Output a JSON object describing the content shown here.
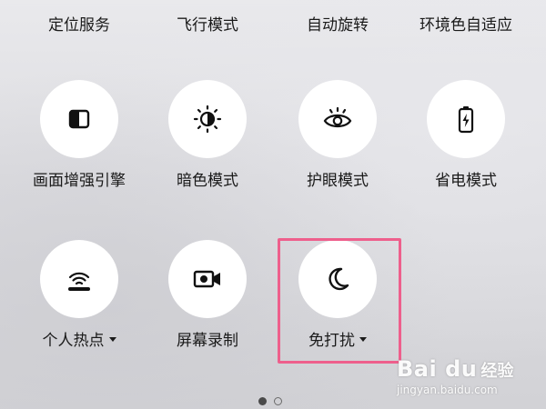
{
  "top_row": [
    {
      "label": "定位服务"
    },
    {
      "label": "飞行模式"
    },
    {
      "label": "自动旋转"
    },
    {
      "label": "环境色自适应"
    }
  ],
  "tiles": [
    {
      "label": "画面增强引擎",
      "icon": "display-enhance-icon",
      "state": "off"
    },
    {
      "label": "暗色模式",
      "icon": "dark-mode-icon",
      "state": "off"
    },
    {
      "label": "护眼模式",
      "icon": "eye-icon",
      "state": "off"
    },
    {
      "label": "省电模式",
      "icon": "battery-saver-icon",
      "state": "off"
    },
    {
      "label": "个人热点",
      "icon": "hotspot-icon",
      "state": "off",
      "has_dropdown": true
    },
    {
      "label": "屏幕录制",
      "icon": "screen-record-icon",
      "state": "off"
    },
    {
      "label": "免打扰",
      "icon": "moon-icon",
      "state": "off",
      "has_dropdown": true,
      "highlighted": true
    }
  ],
  "pager": {
    "total": 2,
    "current": 1
  },
  "watermark": {
    "brand": "Bai du",
    "sub": "经验",
    "url": "jingyan.baidu.com"
  },
  "colors": {
    "highlight": "#ee5f8c",
    "tile_bg": "#ffffff",
    "text": "#1a1a1a"
  }
}
